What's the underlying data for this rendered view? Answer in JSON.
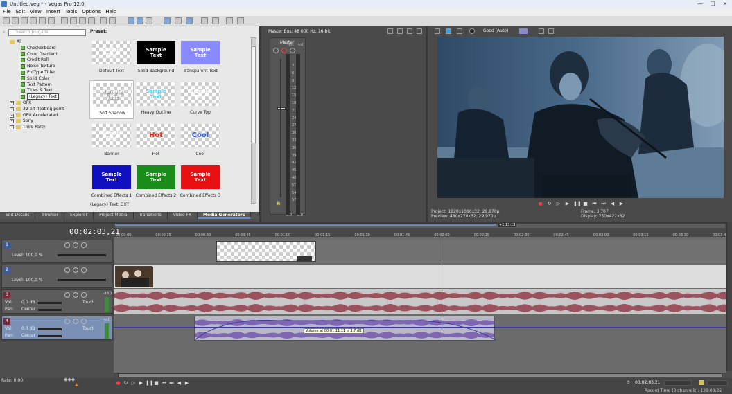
{
  "window": {
    "title": "Untitled.veg * - Vegas Pro 12.0",
    "min": "—",
    "max": "☐",
    "close": "✕"
  },
  "menu": [
    "File",
    "Edit",
    "View",
    "Insert",
    "Tools",
    "Options",
    "Help"
  ],
  "explorer": {
    "search_placeholder": "Search plug-ins",
    "tree": [
      {
        "label": "All",
        "type": "folder"
      },
      {
        "label": "Checkerboard",
        "type": "fx"
      },
      {
        "label": "Color Gradient",
        "type": "fx"
      },
      {
        "label": "Credit Roll",
        "type": "fx"
      },
      {
        "label": "Noise Texture",
        "type": "fx"
      },
      {
        "label": "ProType Titler",
        "type": "fx"
      },
      {
        "label": "Solid Color",
        "type": "fx"
      },
      {
        "label": "Text Pattern",
        "type": "fx"
      },
      {
        "label": "Titles & Text",
        "type": "fx"
      },
      {
        "label": "(Legacy) Text",
        "type": "fx",
        "selected": true
      },
      {
        "label": "OFX",
        "type": "folder"
      },
      {
        "label": "32-bit floating point",
        "type": "folder"
      },
      {
        "label": "GPU Accelerated",
        "type": "folder"
      },
      {
        "label": "Sony",
        "type": "folder"
      },
      {
        "label": "Third Party",
        "type": "folder"
      }
    ]
  },
  "presets": {
    "title": "Preset:",
    "items": [
      {
        "label": "Default Text",
        "text": "Sample\nText"
      },
      {
        "label": "Solid Background",
        "text": "Sample\nText"
      },
      {
        "label": "Transparent Text",
        "text": "Sample\nText"
      },
      {
        "label": "Soft Shadow",
        "text": "Sample\nText"
      },
      {
        "label": "Heavy Outline",
        "text": "Sample\nText"
      },
      {
        "label": "Curve Top",
        "text": "Sample\nText"
      },
      {
        "label": "Banner",
        "text": "Sample\nText"
      },
      {
        "label": "Hot",
        "text": "Hot"
      },
      {
        "label": "Cool",
        "text": "Cool"
      },
      {
        "label": "Combined Effects 1",
        "text": "Sample\nText"
      },
      {
        "label": "Combined Effects 2",
        "text": "Sample\nText"
      },
      {
        "label": "Combined Effects 3",
        "text": "Sample\nText"
      }
    ],
    "footer": "(Legacy) Text: DXT"
  },
  "tabs": [
    "Edit Details",
    "Trimmer",
    "Explorer",
    "Project Media",
    "Transitions",
    "Video FX",
    "Media Generators"
  ],
  "mixer": {
    "title": "Master Bus: 48 000 Hz; 16-bit",
    "channel": "Master",
    "inf_left": "-Inf.",
    "inf_right": "-Inf.",
    "val_left": "0.0",
    "val_right": "0.0",
    "scale": [
      "3",
      "6",
      "9",
      "12",
      "15",
      "18",
      "21",
      "24",
      "27",
      "30",
      "33",
      "36",
      "39",
      "42",
      "45",
      "48",
      "51",
      "54",
      "57"
    ]
  },
  "preview": {
    "quality": "Good (Auto)",
    "project_label": "Project:",
    "project": "1920x1080x32; 29,970p",
    "preview_label": "Preview:",
    "preview": "480x270x32; 29,970p",
    "frame_label": "Frame:",
    "frame": "3 707",
    "display_label": "Display:",
    "display": "750x422x32"
  },
  "timeline": {
    "timecode": "00:02:03,21",
    "ruler": [
      "00:00:00",
      "00:00:15",
      "00:00:30",
      "00:00:45",
      "00:01:00",
      "00:01:15",
      "00:01:30",
      "00:01:45",
      "00:02:00",
      "00:02:15",
      "00:02:30",
      "00:02:45",
      "00:03:00",
      "00:03:15",
      "00:03:30",
      "00:03:45"
    ],
    "region": "+1:13:13",
    "tracks": [
      {
        "num": "1",
        "level": "Level: 100,0 %"
      },
      {
        "num": "2",
        "level": "Level: 100,0 %"
      },
      {
        "num": "3",
        "vol": "Vol:",
        "vol_val": "0,0 dB",
        "pan": "Pan:",
        "pan_val": "Center",
        "mode": "Touch",
        "db": "-16,2"
      },
      {
        "num": "4",
        "vol": "Vol:",
        "vol_val": "0,0 dB",
        "pan": "Pan:",
        "pan_val": "Center",
        "mode": "Touch",
        "db": "-Inf."
      }
    ],
    "tooltip": "Volume at 00:01:11,11 is 3,7 dB",
    "rate": "Rate: 0,00",
    "end_time": "00:02:03,21",
    "status": "Record Time (2 channels): 129:09:25"
  }
}
